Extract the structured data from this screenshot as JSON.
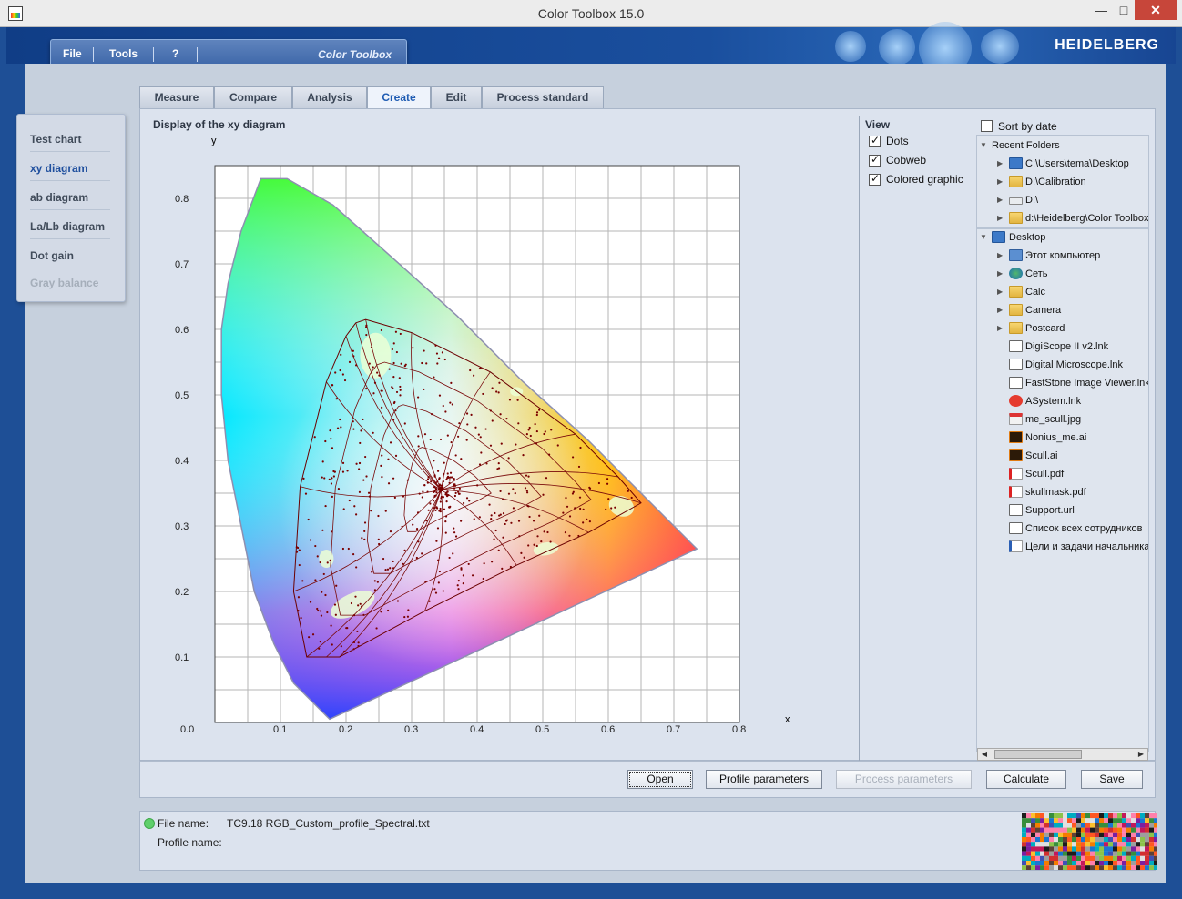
{
  "window": {
    "title": "Color Toolbox 15.0",
    "brand": "HEIDELBERG"
  },
  "menu": {
    "file": "File",
    "tools": "Tools",
    "help": "?",
    "logo": "Color Toolbox"
  },
  "leftnav": [
    {
      "label": "Test chart",
      "state": "normal"
    },
    {
      "label": "xy diagram",
      "state": "active"
    },
    {
      "label": "ab diagram",
      "state": "normal"
    },
    {
      "label": "La/Lb diagram",
      "state": "normal"
    },
    {
      "label": "Dot gain",
      "state": "normal"
    },
    {
      "label": "Gray balance",
      "state": "disabled"
    }
  ],
  "tabs": [
    "Measure",
    "Compare",
    "Analysis",
    "Create",
    "Edit",
    "Process standard"
  ],
  "active_tab": "Create",
  "panel_title": "Display of the xy diagram",
  "chart_data": {
    "type": "scatter",
    "title": "",
    "xlabel": "x",
    "ylabel": "y",
    "xlim": [
      0.0,
      0.8
    ],
    "ylim": [
      0.0,
      0.85
    ],
    "xticks": [
      "0.1",
      "0.2",
      "0.3",
      "0.4",
      "0.5",
      "0.6",
      "0.7",
      "0.8"
    ],
    "yticks": [
      "0.1",
      "0.2",
      "0.3",
      "0.4",
      "0.5",
      "0.6",
      "0.7",
      "0.8"
    ],
    "origin_label": "0.0",
    "grid": true,
    "spectral_locus": [
      [
        0.175,
        0.005
      ],
      [
        0.17,
        0.01
      ],
      [
        0.16,
        0.02
      ],
      [
        0.14,
        0.04
      ],
      [
        0.12,
        0.06
      ],
      [
        0.09,
        0.12
      ],
      [
        0.06,
        0.2
      ],
      [
        0.04,
        0.3
      ],
      [
        0.02,
        0.4
      ],
      [
        0.01,
        0.5
      ],
      [
        0.01,
        0.6
      ],
      [
        0.02,
        0.67
      ],
      [
        0.04,
        0.75
      ],
      [
        0.07,
        0.83
      ],
      [
        0.11,
        0.83
      ],
      [
        0.18,
        0.79
      ],
      [
        0.27,
        0.71
      ],
      [
        0.37,
        0.62
      ],
      [
        0.47,
        0.52
      ],
      [
        0.57,
        0.43
      ],
      [
        0.65,
        0.35
      ],
      [
        0.735,
        0.265
      ]
    ],
    "gamut_outline": [
      [
        0.215,
        0.61
      ],
      [
        0.23,
        0.615
      ],
      [
        0.3,
        0.595
      ],
      [
        0.42,
        0.535
      ],
      [
        0.55,
        0.44
      ],
      [
        0.615,
        0.375
      ],
      [
        0.65,
        0.335
      ],
      [
        0.57,
        0.29
      ],
      [
        0.46,
        0.24
      ],
      [
        0.32,
        0.17
      ],
      [
        0.19,
        0.1
      ],
      [
        0.17,
        0.1
      ],
      [
        0.14,
        0.1
      ],
      [
        0.12,
        0.2
      ],
      [
        0.13,
        0.36
      ],
      [
        0.17,
        0.52
      ],
      [
        0.2,
        0.59
      ]
    ],
    "highlights": [
      [
        0.245,
        0.56
      ],
      [
        0.21,
        0.18
      ],
      [
        0.17,
        0.25
      ],
      [
        0.505,
        0.265
      ],
      [
        0.62,
        0.33
      ],
      [
        0.46,
        0.505
      ]
    ],
    "white_point": [
      0.345,
      0.355
    ]
  },
  "view": {
    "title": "View",
    "options": [
      {
        "label": "Dots",
        "checked": true
      },
      {
        "label": "Cobweb",
        "checked": true
      },
      {
        "label": "Colored graphic",
        "checked": true
      }
    ]
  },
  "browser": {
    "sort_label": "Sort by date",
    "sort_checked": false,
    "recent_label": "Recent Folders",
    "recent": [
      {
        "label": "C:\\Users\\tema\\Desktop",
        "icon": "desktop"
      },
      {
        "label": "D:\\Calibration",
        "icon": "folder"
      },
      {
        "label": "D:\\",
        "icon": "drive"
      },
      {
        "label": "d:\\Heidelberg\\Color Toolbox",
        "icon": "folder"
      }
    ],
    "desktop_label": "Desktop",
    "items": [
      {
        "label": "Этот компьютер",
        "icon": "computer",
        "expandable": true
      },
      {
        "label": "Сеть",
        "icon": "net",
        "expandable": true
      },
      {
        "label": "Calc",
        "icon": "folder",
        "expandable": true
      },
      {
        "label": "Camera",
        "icon": "folder",
        "expandable": true
      },
      {
        "label": "Postcard",
        "icon": "folder",
        "expandable": true
      },
      {
        "label": "DigiScope II v2.lnk",
        "icon": "lnk",
        "expandable": false
      },
      {
        "label": "Digital Microscope.lnk",
        "icon": "lnk",
        "expandable": false
      },
      {
        "label": "FastStone Image Viewer.lnk",
        "icon": "lnk",
        "expandable": false
      },
      {
        "label": "ASystem.lnk",
        "icon": "red",
        "expandable": false
      },
      {
        "label": "me_scull.jpg",
        "icon": "jpg",
        "expandable": false
      },
      {
        "label": "Nonius_me.ai",
        "icon": "ai",
        "expandable": false
      },
      {
        "label": "Scull.ai",
        "icon": "ai",
        "expandable": false
      },
      {
        "label": "Scull.pdf",
        "icon": "pdf",
        "expandable": false
      },
      {
        "label": "skullmask.pdf",
        "icon": "pdf",
        "expandable": false
      },
      {
        "label": "Support.url",
        "icon": "lnk",
        "expandable": false
      },
      {
        "label": "Список всех сотрудников",
        "icon": "lnk",
        "expandable": false
      },
      {
        "label": "Цели и задачи начальника",
        "icon": "doc",
        "expandable": false
      }
    ]
  },
  "buttons": {
    "open": "Open",
    "profile": "Profile parameters",
    "process": "Process parameters",
    "calculate": "Calculate",
    "save": "Save"
  },
  "status": {
    "file_label": "File name:",
    "file_value": "TC9.18 RGB_Custom_profile_Spectral.txt",
    "profile_label": "Profile name:",
    "profile_value": ""
  }
}
